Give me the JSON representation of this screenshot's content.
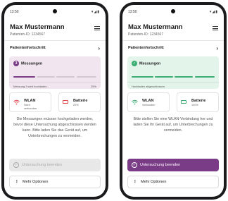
{
  "left": {
    "status_time": "13:50",
    "status_icons": "▾◢▮",
    "patient_name": "Max Mustermann",
    "patient_id": "Patienten-ID: 1234567",
    "progress_title": "Patientenfortschritt",
    "progress_chevron": "›",
    "card_badge": "3",
    "card_title": "Messungen",
    "card_status": "Messung 3 wird hochladen...",
    "card_percent": "25%",
    "progress_value": 0.25,
    "wlan_label": "WLAN",
    "wlan_sub": "Nicht verbunden",
    "battery_label": "Batterie",
    "battery_sub": "20%",
    "message": "Die Messungen müssen hochgeladen werden, bevor diese Untersuchung abgeschlossen werden kann. Bitte laden Sie das Gerät auf, um Unterbrechungen zu vermeiden.",
    "end_button": "Untersuchung beenden",
    "more_button": "Mehr Optionen",
    "accent": "#7a3c86",
    "warn": "#e0454b"
  },
  "right": {
    "status_time": "13:50",
    "status_icons": "▾◢▮",
    "patient_name": "Max Mustermann",
    "patient_id": "Patienten-ID: 1234567",
    "progress_title": "Patientenfortschritt",
    "progress_chevron": "›",
    "card_badge": "✓",
    "card_title": "Messungen",
    "card_status": "Hochladen abgeschlossen",
    "progress_value": 1.0,
    "wlan_label": "WLAN",
    "wlan_sub": "Verbunden",
    "battery_label": "Batterie",
    "battery_sub": "100%",
    "message": "Bitte stellen Sie eine WLAN-Verbindung her und laden Sie Ihr Gerät auf, um Unterbrechungen zu vermeiden.",
    "end_button": "Untersuchung beenden",
    "more_button": "Mehr Optionen",
    "accent": "#3cae73"
  }
}
